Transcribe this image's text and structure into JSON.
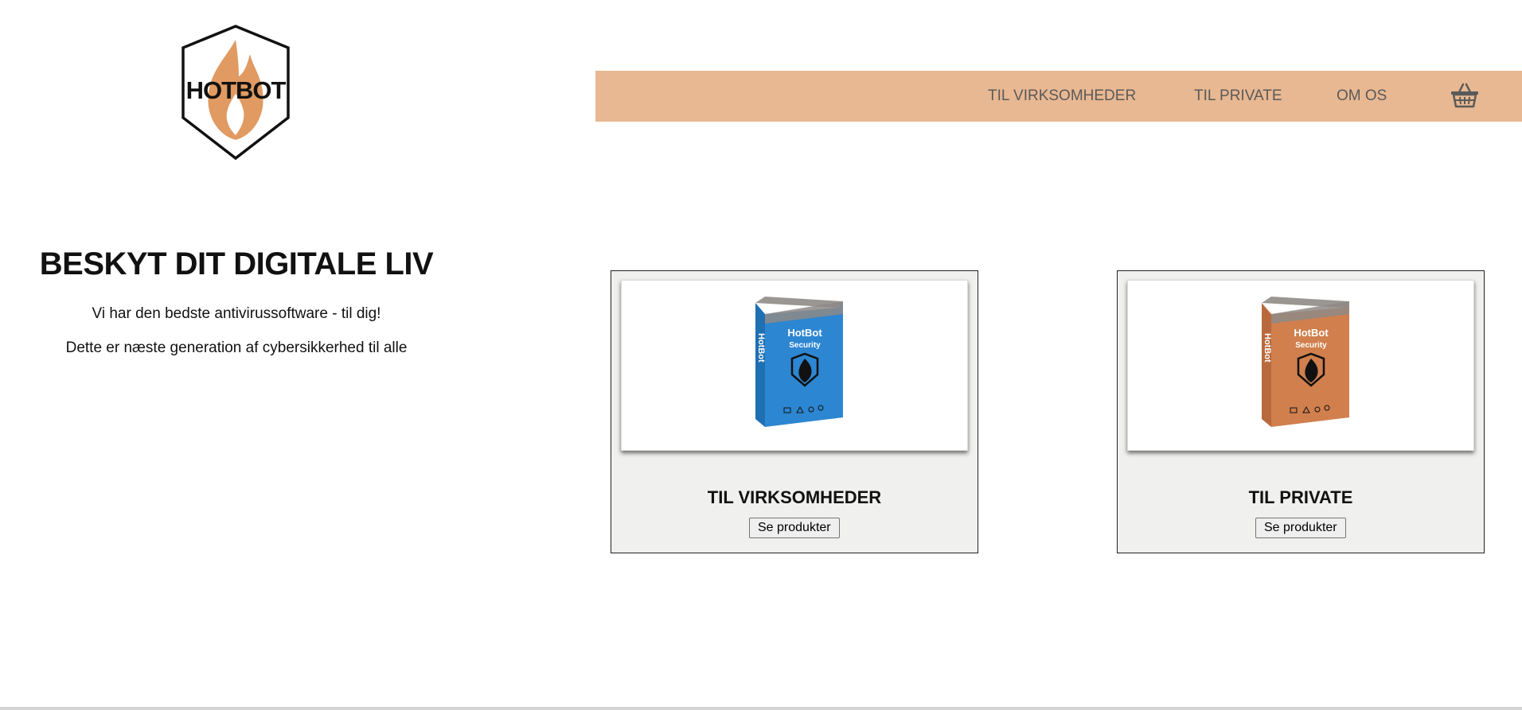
{
  "brand": {
    "logo_text": "HOTBOT",
    "accent": "#e8b892",
    "flame": "#e09a62"
  },
  "nav": {
    "items": [
      {
        "label": "TIL VIRKSOMHEDER"
      },
      {
        "label": "TIL PRIVATE"
      },
      {
        "label": "OM OS"
      }
    ],
    "cart_icon": "basket-icon"
  },
  "hero": {
    "title": "BESKYT DIT DIGITALE LIV",
    "line1": "Vi har den bedste antivirussoftware - til dig!",
    "line2": "Dette er næste generation af cybersikkerhed til alle"
  },
  "cards": [
    {
      "title": "TIL VIRKSOMHEDER",
      "button": "Se produkter",
      "box": {
        "brand": "HotBot",
        "product": "Security",
        "color": "#2d86d1"
      }
    },
    {
      "title": "TIL PRIVATE",
      "button": "Se produkter",
      "box": {
        "brand": "HotBot",
        "product": "Security",
        "color": "#d07f4d"
      }
    }
  ]
}
